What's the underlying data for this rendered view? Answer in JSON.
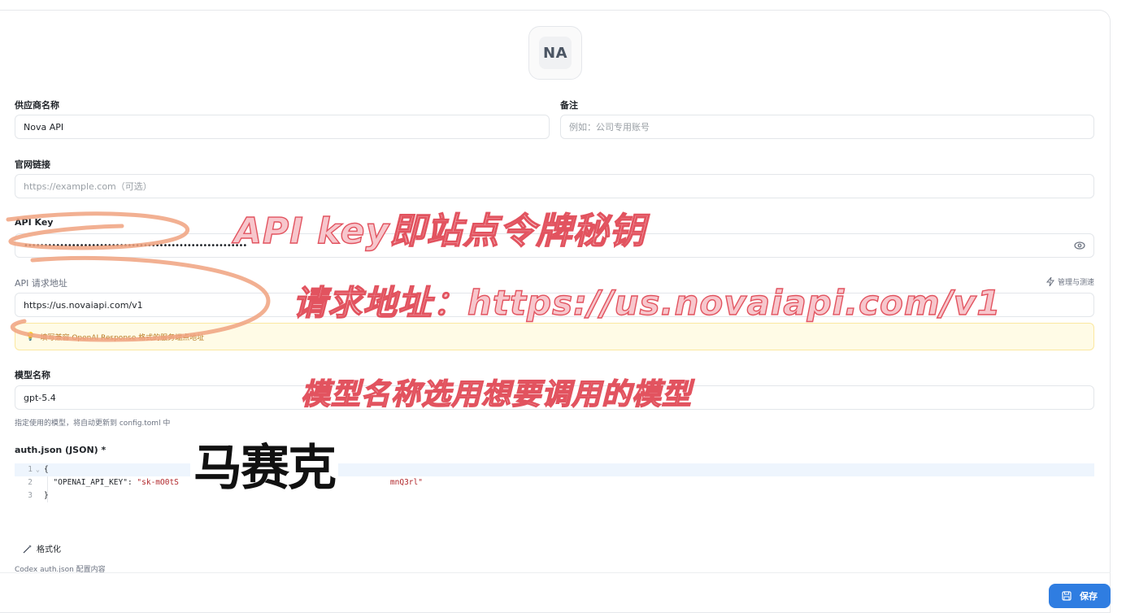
{
  "avatar": {
    "initials": "NA"
  },
  "fields": {
    "provider_name": {
      "label": "供应商名称",
      "value": "Nova API"
    },
    "remark": {
      "label": "备注",
      "placeholder": "例如：公司专用账号"
    },
    "website": {
      "label": "官网链接",
      "placeholder": "https://example.com（可选）"
    },
    "api_key": {
      "label": "API Key",
      "value": "••••••••••••••••••••••••••••••••••••••••••••••••••••••••"
    },
    "api_url": {
      "label": "API 请求地址",
      "value": "https://us.novaiapi.com/v1",
      "manage_label": "管理与测速"
    },
    "notice": {
      "text": "填写兼容 OpenAI Response 格式的服务端点地址"
    },
    "model": {
      "label": "模型名称",
      "value": "gpt-5.4",
      "hint": "指定使用的模型，将自动更新到 config.toml 中"
    },
    "auth_json": {
      "label": "auth.json (JSON) *",
      "hint": "Codex auth.json 配置内容"
    }
  },
  "editor": {
    "lines": [
      {
        "num": "1",
        "text": "{"
      },
      {
        "num": "2",
        "key": "\"OPENAI_API_KEY\"",
        "sep": ": ",
        "value_start": "\"sk-mO0tS",
        "value_end": "mnQ3rl\""
      },
      {
        "num": "3",
        "text": "}"
      }
    ]
  },
  "buttons": {
    "format": "格式化",
    "save": "保存"
  },
  "annotations": {
    "api_key_note": "API key即站点令牌秘钥",
    "url_note": "请求地址：https://us.novaiapi.com/v1",
    "model_note": "模型名称选用想要调用的模型",
    "stamp": "马赛克"
  },
  "colors": {
    "accent": "#2f7de1",
    "notice_bg": "#fffbe6",
    "annotation": "#e2535f",
    "scribble": "#f0a27f"
  }
}
